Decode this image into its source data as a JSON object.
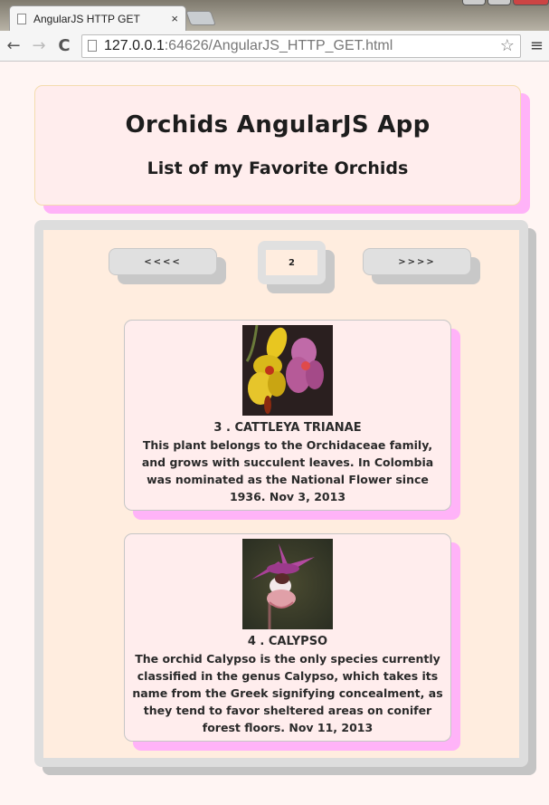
{
  "browser": {
    "tab_title": "AngularJS HTTP GET",
    "tab_close": "×",
    "url_host": "127.0.0.1",
    "url_path": ":64626/AngularJS_HTTP_GET.html",
    "back": "←",
    "forward": "→",
    "reload": "C",
    "star": "☆",
    "menu": "≡"
  },
  "header": {
    "title": "Orchids AngularJS App",
    "subtitle": "List of my Favorite Orchids"
  },
  "pagination": {
    "prev_label": "<<<<",
    "next_label": ">>>>",
    "current_page": "2"
  },
  "orchids": [
    {
      "title": "3 . CATTLEYA TRIANAE",
      "description": "This plant belongs to the Orchidaceae family, and grows with succulent leaves. In Colombia was nominated as the National Flower since 1936. Nov 3, 2013",
      "image": "yellow-and-pink-orchid-photo"
    },
    {
      "title": "4 . CALYPSO",
      "description": "The orchid Calypso is the only species currently classified in the genus Calypso, which takes its name from the Greek signifying concealment, as they tend to favor sheltered areas on conifer forest floors. Nov 11, 2013",
      "image": "purple-calypso-orchid-photo"
    }
  ],
  "colors": {
    "page_bg": "#fff5f3",
    "card_bg": "#ffeded",
    "card_shadow": "#ffb3f8",
    "panel_bg": "#ffeddf",
    "panel_border": "#dddddd"
  }
}
